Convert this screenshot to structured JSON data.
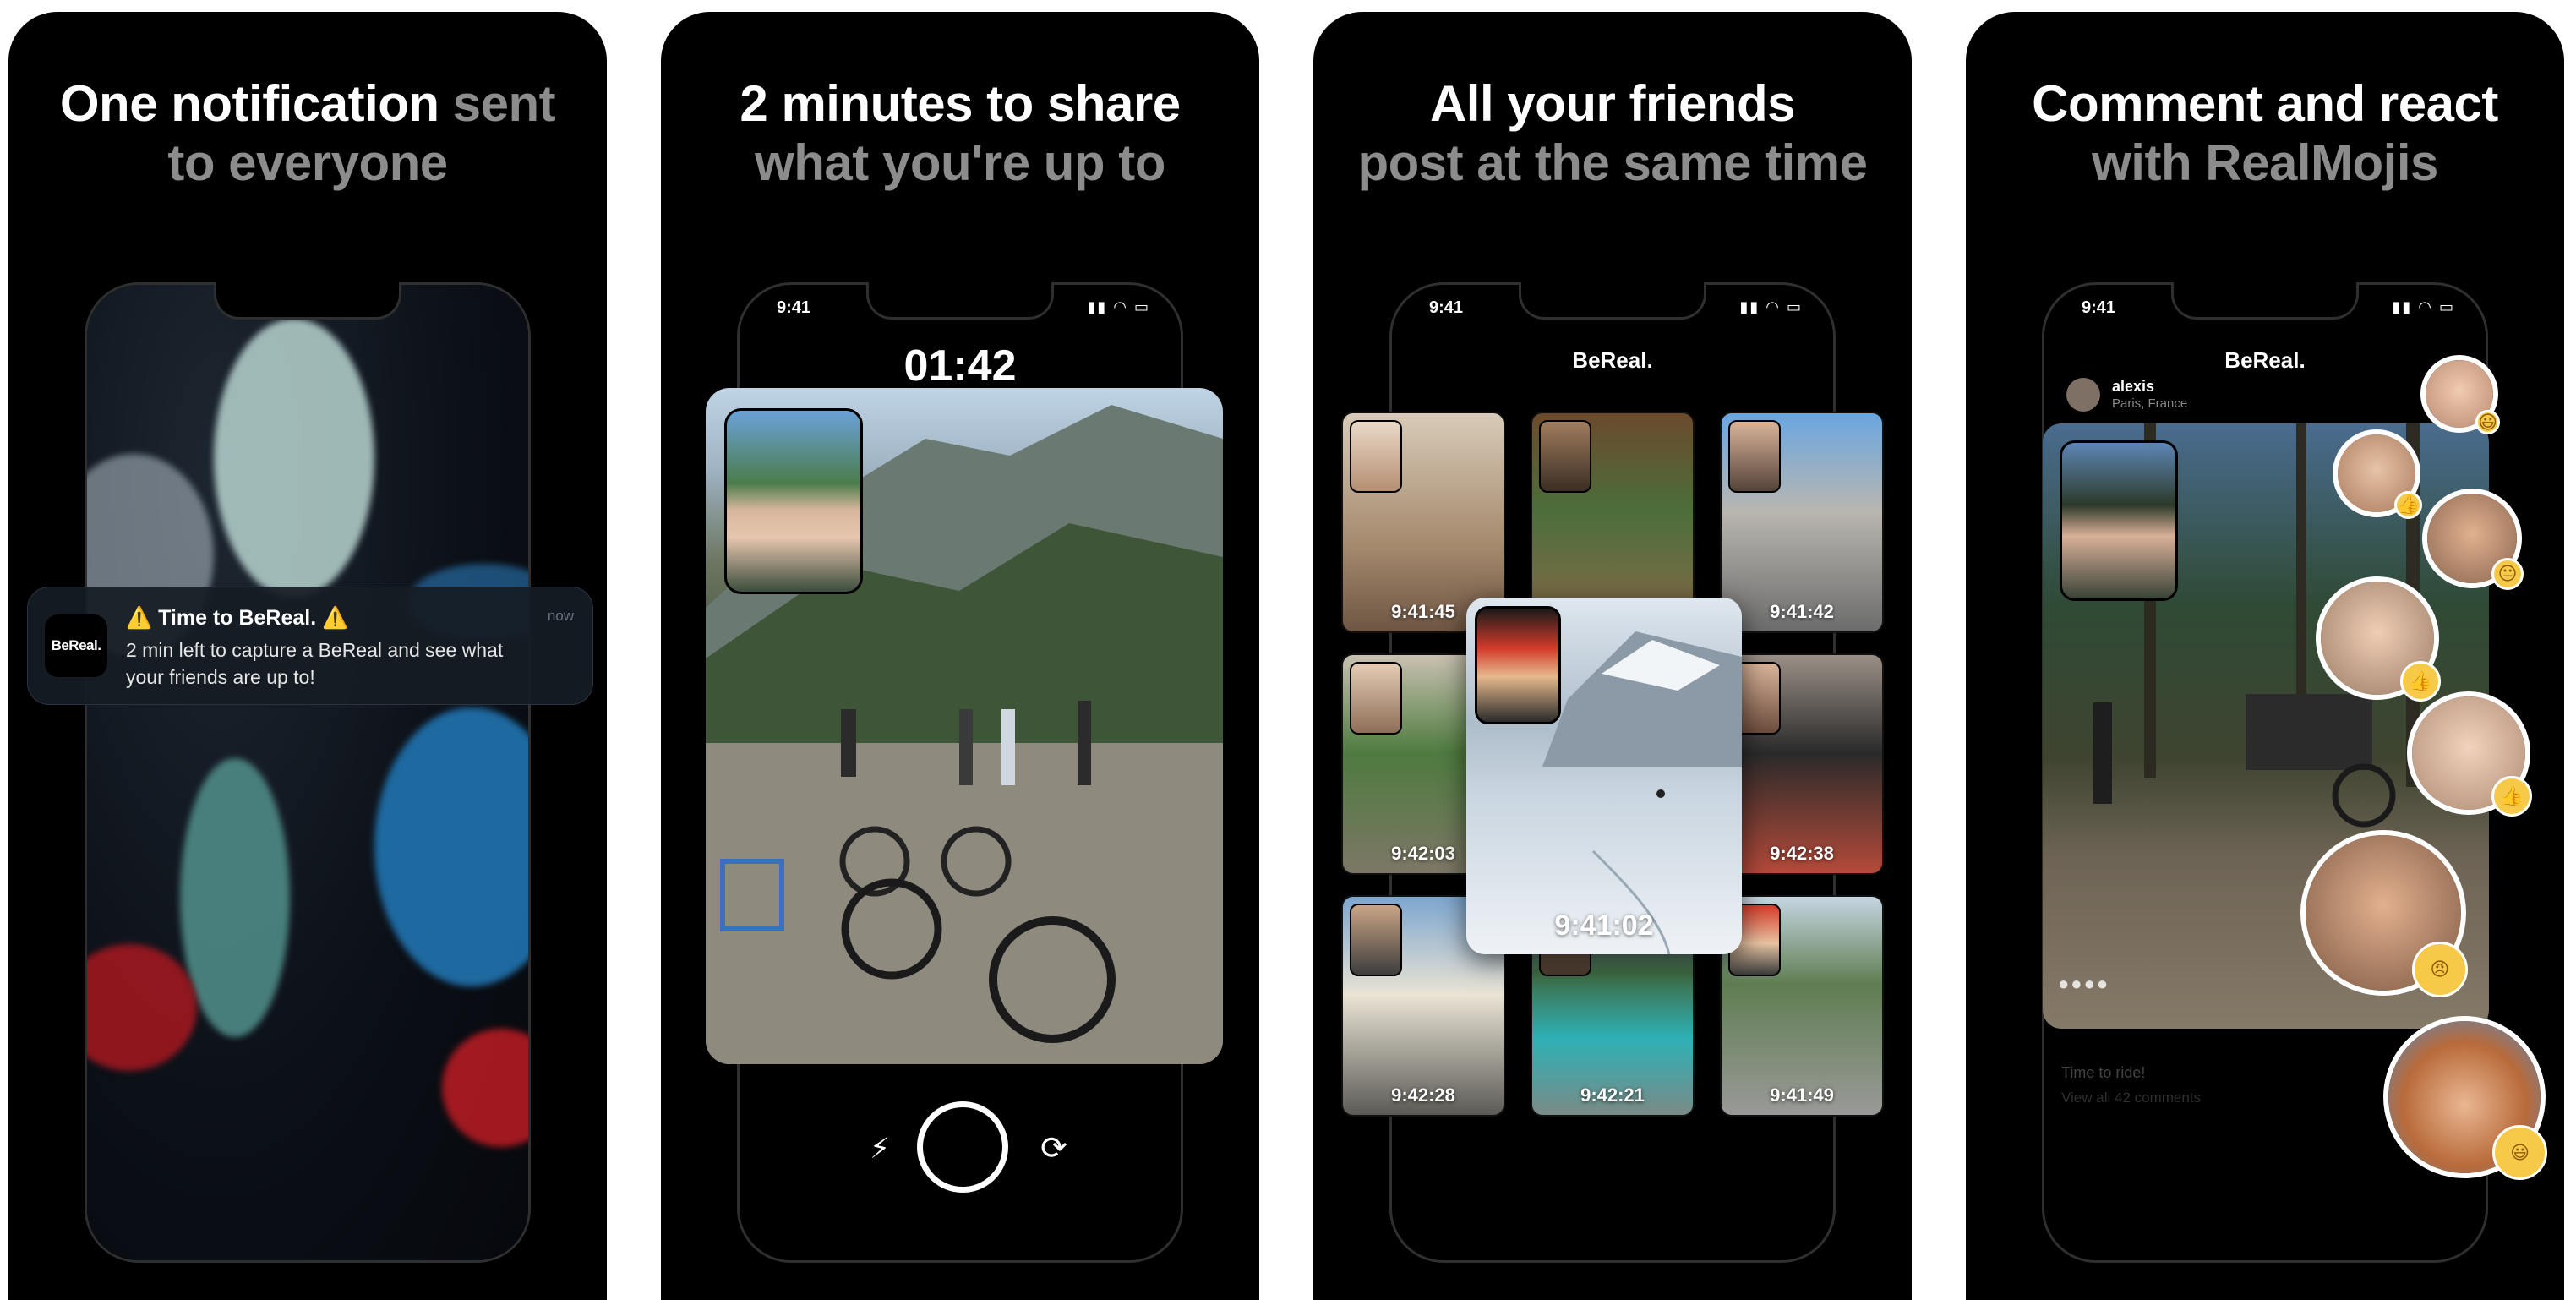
{
  "panels": [
    {
      "headline_white": "One notification",
      "headline_grey": "sent",
      "headline_line2": "to everyone"
    },
    {
      "headline_white": "2 minutes to share",
      "headline_line2": "what you're up to"
    },
    {
      "headline_white": "All your friends",
      "headline_line2": "post at the same time"
    },
    {
      "headline_white": "Comment and react",
      "headline_line2": "with RealMojis"
    }
  ],
  "status_bar": {
    "time": "9:41",
    "icons": "signal-icon wifi-icon battery-icon"
  },
  "notification": {
    "app_icon_label": "BeReal.",
    "title": "⚠️ Time to BeReal. ⚠️",
    "body": "2 min left to capture a BeReal and see what your friends are up to!",
    "time": "now"
  },
  "camera": {
    "timer": "01:42",
    "flash_icon": "flash-off-icon",
    "shutter_icon": "shutter-button",
    "flip_icon": "flip-camera-icon"
  },
  "app_title": "BeReal.",
  "grid": {
    "timestamps": [
      "9:41:45",
      "",
      "9:41:42",
      "9:42:03",
      "9:42:38",
      "9:42:28",
      "9:42:21",
      "9:41:49"
    ],
    "featured_timestamp": "9:41:02"
  },
  "feed": {
    "username": "alexis",
    "location": "Paris, France",
    "caption": "Time to ride!",
    "comments_link": "View all 42 comments"
  },
  "realmojis": [
    "😃",
    "👍",
    "😐",
    "👍",
    "👍",
    "😠",
    "😃"
  ]
}
